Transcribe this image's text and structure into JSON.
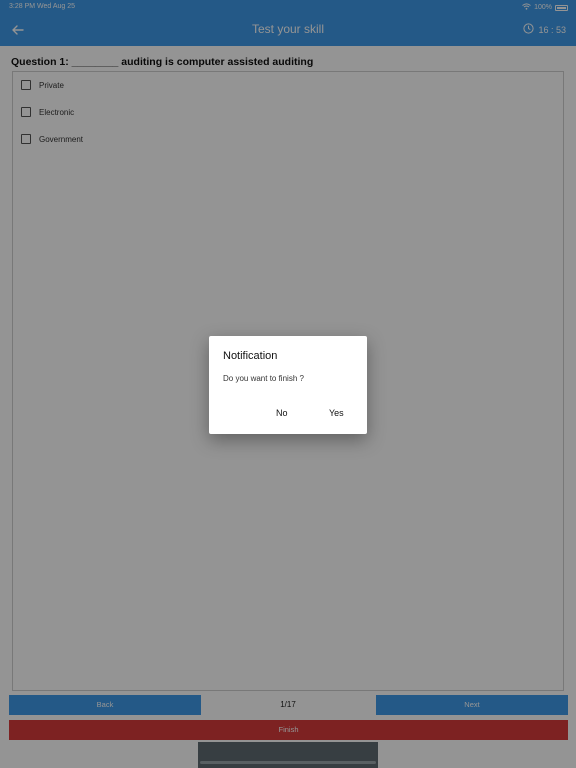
{
  "status_bar": {
    "time": "3:28 PM   Wed Aug 25",
    "battery": "100%"
  },
  "header": {
    "title": "Test your skill",
    "timer": "16 : 53"
  },
  "question": {
    "text": "Question 1: ________ auditing is computer assisted auditing"
  },
  "options": [
    {
      "label": "Private"
    },
    {
      "label": "Electronic"
    },
    {
      "label": "Government"
    }
  ],
  "navigation": {
    "back_label": "Back",
    "page_indicator": "1/17",
    "next_label": "Next",
    "finish_label": "Finish"
  },
  "dialog": {
    "title": "Notification",
    "message": "Do you want to finish ?",
    "no_label": "No",
    "yes_label": "Yes"
  },
  "colors": {
    "primary": "#3f9ae8",
    "finish": "#d83b3b"
  }
}
